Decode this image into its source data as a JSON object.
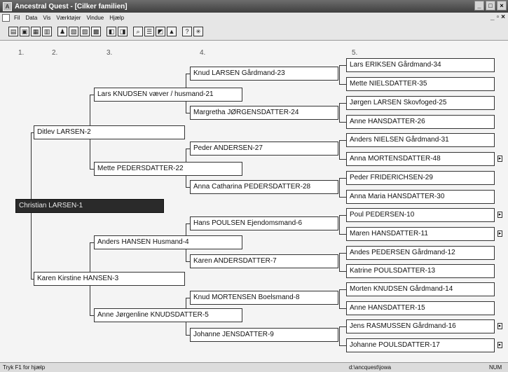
{
  "window": {
    "title": "Ancestral Quest - [Cilker familien]"
  },
  "menu": [
    "Fil",
    "Data",
    "Vis",
    "Værktøjer",
    "Vindue",
    "Hjælp"
  ],
  "generations": [
    "1.",
    "2.",
    "3.",
    "4.",
    "5."
  ],
  "people": {
    "p1": "Christian LARSEN-1",
    "p2": "Ditlev LARSEN-2",
    "p3": "Karen Kirstine HANSEN-3",
    "p21": "Lars KNUDSEN væver / husmand-21",
    "p22": "Mette PEDERSDATTER-22",
    "p4": "Anders HANSEN Husmand-4",
    "p5": "Anne Jørgenline KNUDSDATTER-5",
    "p23": "Knud LARSEN Gårdmand-23",
    "p24": "Margretha JØRGENSDATTER-24",
    "p27": "Peder ANDERSEN-27",
    "p28": "Anna Catharina PEDERSDATTER-28",
    "p6": "Hans POULSEN Ejendomsmand-6",
    "p7": "Karen ANDERSDATTER-7",
    "p8": "Knud MORTENSEN Boelsmand-8",
    "p9": "Johanne JENSDATTER-9",
    "p34": "Lars ERIKSEN Gårdmand-34",
    "p35": "Mette NIELSDATTER-35",
    "p25": "Jørgen LARSEN Skovfoged-25",
    "p26": "Anne HANSDATTER-26",
    "p31": "Anders NIELSEN Gårdmand-31",
    "p48": "Anna MORTENSDATTER-48",
    "p29": "Peder FRIDERICHSEN-29",
    "p30": "Anna Maria HANSDATTER-30",
    "p10": "Poul PEDERSEN-10",
    "p11": "Maren HANSDATTER-11",
    "p12": "Andes PEDERSEN Gårdmand-12",
    "p13": "Katrine POULSDATTER-13",
    "p14": "Morten KNUDSEN Gårdmand-14",
    "p15": "Anne HANSDATTER-15",
    "p16": "Jens RASMUSSEN Gårdmand-16",
    "p17": "Johanne POULSDATTER-17"
  },
  "status": {
    "help": "Tryk F1 for hjælp",
    "path": "d:\\ancquest\\jowa",
    "mode": "NUM"
  }
}
